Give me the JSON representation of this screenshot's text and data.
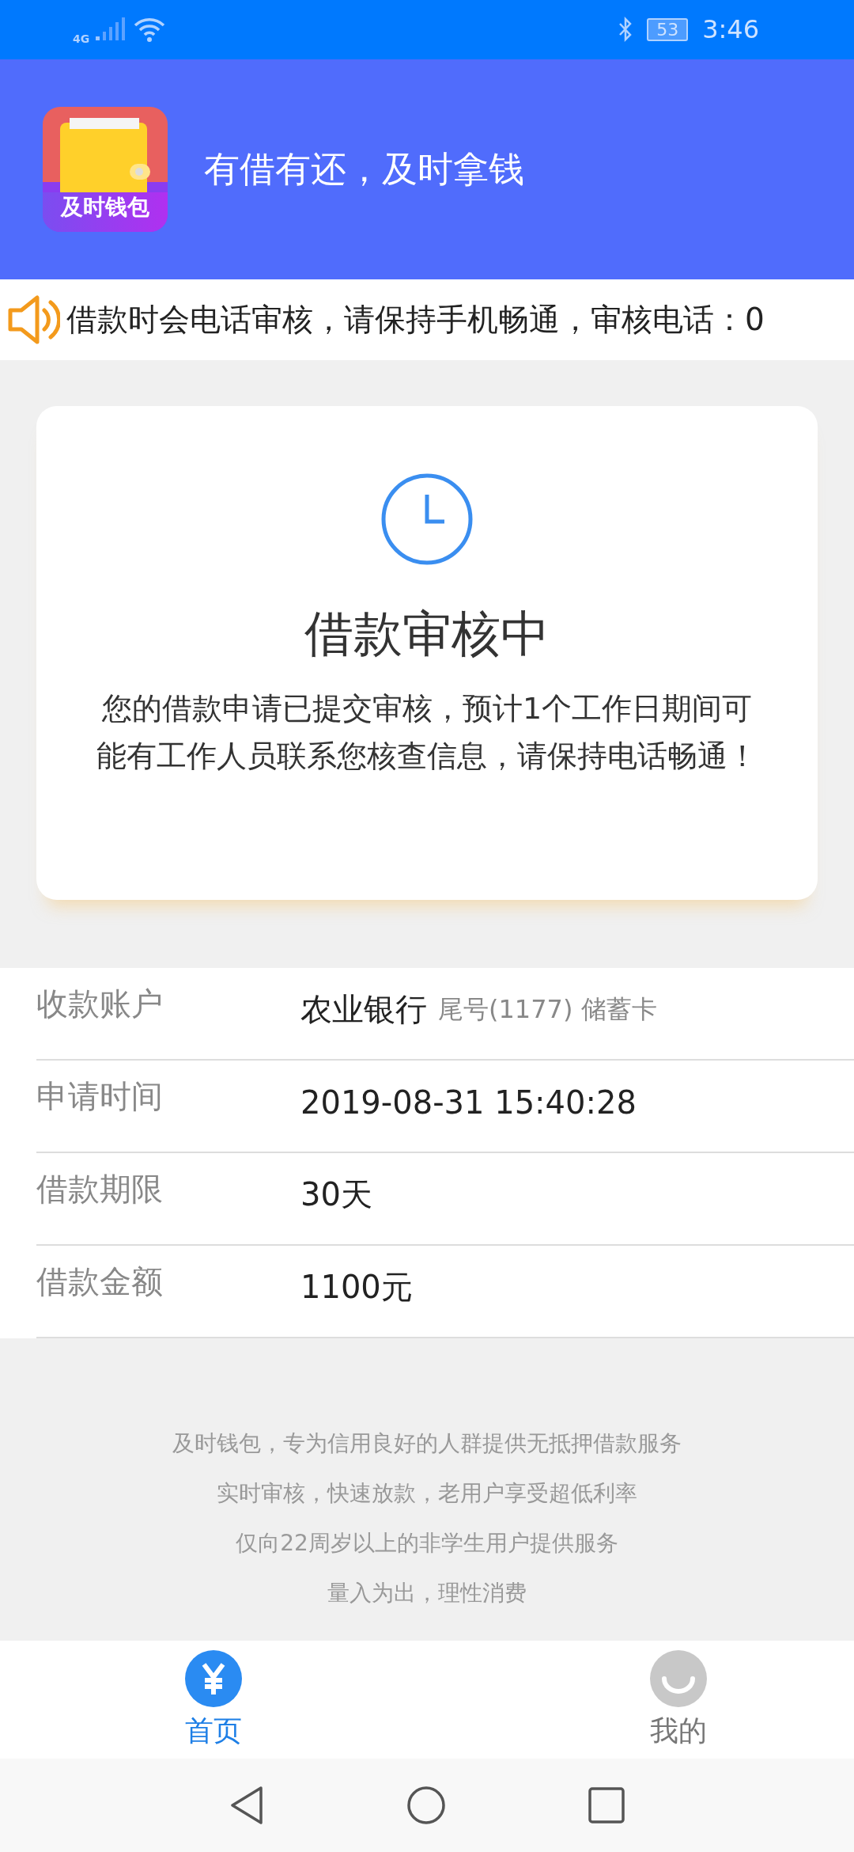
{
  "status_bar": {
    "network": "4G",
    "battery": "53",
    "time": "3:46"
  },
  "header": {
    "logo_text": "及时钱包",
    "slogan": "有借有还，及时拿钱"
  },
  "notice": {
    "text": "借款时会电话审核，请保持手机畅通，审核电话：0"
  },
  "status_card": {
    "title": "借款审核中",
    "message": "您的借款申请已提交审核，预计1个工作日期间可能有工作人员联系您核查信息，请保持电话畅通！"
  },
  "details": [
    {
      "label": "收款账户",
      "value": "农业银行",
      "note": "尾号(1177) 储蓄卡"
    },
    {
      "label": "申请时间",
      "value": "2019-08-31 15:40:28"
    },
    {
      "label": "借款期限",
      "value": "30天"
    },
    {
      "label": "借款金额",
      "value": "1100元"
    }
  ],
  "footer_lines": [
    "及时钱包，专为信用良好的人群提供无抵押借款服务",
    "实时审核，快速放款，老用户享受超低利率",
    "仅向22周岁以上的非学生用户提供服务",
    "量入为出，理性消费"
  ],
  "tabs": [
    {
      "label": "首页",
      "kind": "yuan",
      "selected": true
    },
    {
      "label": "我的",
      "kind": "smile",
      "selected": false
    }
  ]
}
